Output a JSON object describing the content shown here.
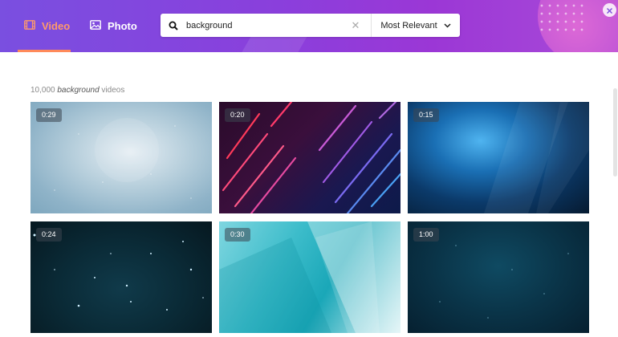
{
  "tabs": [
    {
      "label": "Video",
      "icon": "film-icon",
      "active": true
    },
    {
      "label": "Photo",
      "icon": "image-icon",
      "active": false
    }
  ],
  "search": {
    "value": "background",
    "placeholder": "",
    "sort_label": "Most Relevant"
  },
  "results": {
    "count": "10,000",
    "query": "background",
    "suffix": "videos"
  },
  "videos": [
    {
      "duration": "0:29"
    },
    {
      "duration": "0:20"
    },
    {
      "duration": "0:15"
    },
    {
      "duration": "0:24"
    },
    {
      "duration": "0:30"
    },
    {
      "duration": "1:00"
    }
  ],
  "colors": {
    "header_start": "#7a4fe0",
    "header_end": "#a94bd8",
    "active_tab": "#ff9a6a"
  }
}
